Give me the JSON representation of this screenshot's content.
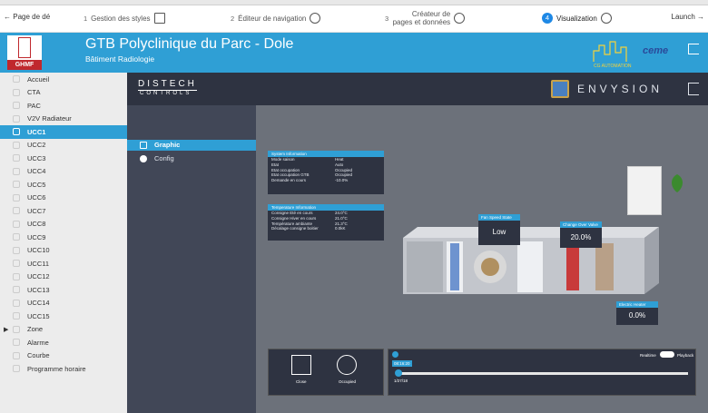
{
  "wizard": {
    "back_label": "Page de dé",
    "steps": [
      {
        "num": "1",
        "label": "Gestion des styles"
      },
      {
        "num": "2",
        "label": "Éditeur de navigation"
      },
      {
        "num": "3",
        "label": "Créateur de pages et données"
      },
      {
        "num": "4",
        "label": "Visualization"
      }
    ],
    "launch_label": "Launch"
  },
  "header": {
    "title": "GTB Polyclinique du Parc - Dole",
    "subtitle": "Bâtiment Radiologie",
    "logo_text": "GHMF",
    "partner_logo": "CG AUTOMATION",
    "ceme": "ceme"
  },
  "sidebar": {
    "items": [
      {
        "label": "Accueil"
      },
      {
        "label": "CTA"
      },
      {
        "label": "PAC"
      },
      {
        "label": "V2V Radiateur"
      },
      {
        "label": "UCC1"
      },
      {
        "label": "UCC2"
      },
      {
        "label": "UCC3"
      },
      {
        "label": "UCC4"
      },
      {
        "label": "UCC5"
      },
      {
        "label": "UCC6"
      },
      {
        "label": "UCC7"
      },
      {
        "label": "UCC8"
      },
      {
        "label": "UCC9"
      },
      {
        "label": "UCC10"
      },
      {
        "label": "UCC11"
      },
      {
        "label": "UCC12"
      },
      {
        "label": "UCC13"
      },
      {
        "label": "UCC14"
      },
      {
        "label": "UCC15"
      },
      {
        "label": "Zone"
      },
      {
        "label": "Alarme"
      },
      {
        "label": "Courbe"
      },
      {
        "label": "Programme horaire"
      }
    ],
    "selected": "UCC1"
  },
  "app": {
    "brand": "DISTECH",
    "brand_sub": "CONTROLS",
    "envysion": "ENVYSION",
    "nav": {
      "graphic": "Graphic",
      "config": "Config"
    }
  },
  "system_info": {
    "title": "System Information",
    "rows": [
      {
        "k": "Mode saison",
        "v": "Heat"
      },
      {
        "k": "Etat",
        "v": "Auto"
      },
      {
        "k": "Etat occupation",
        "v": "Occupied"
      },
      {
        "k": "Etat occupation GTB",
        "v": "Occupied"
      },
      {
        "k": "Demande en cours",
        "v": "-10.0%"
      }
    ]
  },
  "temperature_info": {
    "title": "Temperature Information",
    "rows": [
      {
        "k": "Consigne Eté en cours",
        "v": "24.0°C"
      },
      {
        "k": "Consigne Hiver en cours",
        "v": "21.0°C"
      },
      {
        "k": "Température ambiante",
        "v": "21.3°C"
      },
      {
        "k": "Décalage consigne boitier",
        "v": "0.0kK"
      }
    ]
  },
  "badges": {
    "fan": {
      "title": "Fan Speed State",
      "value": "Low"
    },
    "cov": {
      "title": "Change Over Valve",
      "value": "20.0%"
    },
    "heater": {
      "title": "Electric Heater",
      "value": "0.0%"
    }
  },
  "controls": {
    "close": "Close",
    "occupied": "Occupied"
  },
  "playback": {
    "time": "08:16:20",
    "date": "1/27/18",
    "realtime": "Realtime",
    "playback": "Playback"
  }
}
